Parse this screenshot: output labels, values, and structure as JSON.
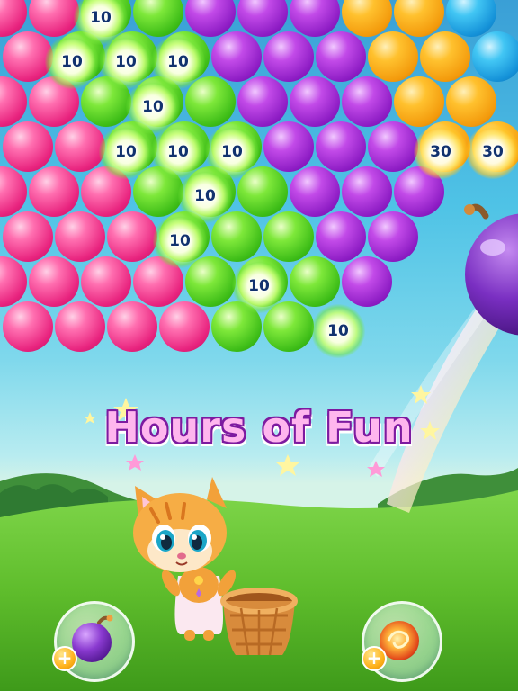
{
  "screen": {
    "title_banner": "Hours of Fun"
  },
  "score_pops": [
    {
      "label": "10"
    },
    {
      "label": "10"
    },
    {
      "label": "10"
    },
    {
      "label": "10"
    },
    {
      "label": "10"
    },
    {
      "label": "10"
    },
    {
      "label": "10"
    },
    {
      "label": "10"
    },
    {
      "label": "10"
    },
    {
      "label": "10"
    },
    {
      "label": "10"
    },
    {
      "label": "10"
    },
    {
      "label": "30"
    },
    {
      "label": "30"
    }
  ],
  "bubble_colors": {
    "pink": "#e8237e",
    "green": "#3cbc17",
    "purple": "#8d1cc4",
    "orange": "#f39a0c",
    "blue": "#1491d8"
  },
  "boosters": {
    "left": {
      "icon": "bomb-icon",
      "badge": "+"
    },
    "right": {
      "icon": "fireball-icon",
      "badge": "+"
    }
  },
  "character": {
    "icon": "cat-icon"
  },
  "basket": {
    "icon": "basket-icon"
  }
}
